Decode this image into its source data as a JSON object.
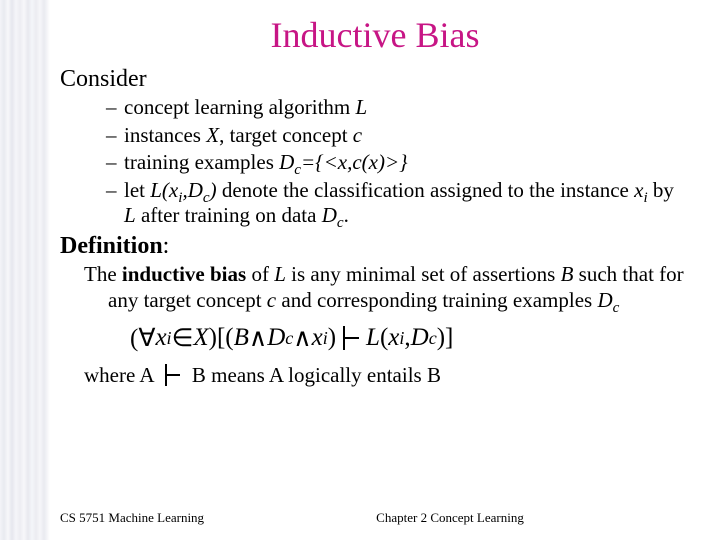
{
  "title": "Inductive Bias",
  "consider_label": "Consider",
  "bullets": {
    "b1_pre": "concept learning algorithm ",
    "b1_L": "L",
    "b2_pre": "instances ",
    "b2_X": "X",
    "b2_mid": ", target concept ",
    "b2_c": "c",
    "b3_pre": "training examples ",
    "b3_Dc": "D",
    "b3_Dc_sub": "c",
    "b3_post": "={<x,c(x)>}",
    "b4_pre": "let ",
    "b4_Lxi": "L(x",
    "b4_i": "i",
    "b4_mid1": ",D",
    "b4_c": "c",
    "b4_close": ")",
    "b4_txt1": " denote the classification assigned to the instance ",
    "b4_xi": "x",
    "b4_i2": "i",
    "b4_txt2": " by ",
    "b4_L": "L",
    "b4_txt3": " after training on data ",
    "b4_Dc2": "D",
    "b4_c2": "c",
    "b4_end": "."
  },
  "definition_label": "Definition",
  "definition_colon": ":",
  "def_para": {
    "pre": "The ",
    "ib": "inductive bias",
    "mid1": " of ",
    "L": "L",
    "mid2": " is any minimal set of assertions ",
    "B": "B",
    "mid3": " such that for any target concept ",
    "c": "c",
    "mid4": " and corresponding training examples ",
    "Dc": "D",
    "Dc_sub": "c"
  },
  "formula": {
    "forall": "(∀",
    "x": "x",
    "i": "i",
    "in": " ∈ ",
    "X": "X",
    "mid1": ")[(",
    "B": "B",
    "and1": " ∧ ",
    "D": "D",
    "c": "c",
    "and2": " ∧ ",
    "x2": "x",
    "i2": "i",
    "close1": ")",
    "L": "L",
    "open2": "(",
    "x3": "x",
    "i3": "i",
    "comma": ", ",
    "D2": "D",
    "c2": "c",
    "close2": ")]"
  },
  "where": {
    "pre": "where A",
    "post": "B means A logically entails B"
  },
  "footer": {
    "left": "CS 5751 Machine Learning",
    "center": "Chapter 2  Concept Learning"
  }
}
